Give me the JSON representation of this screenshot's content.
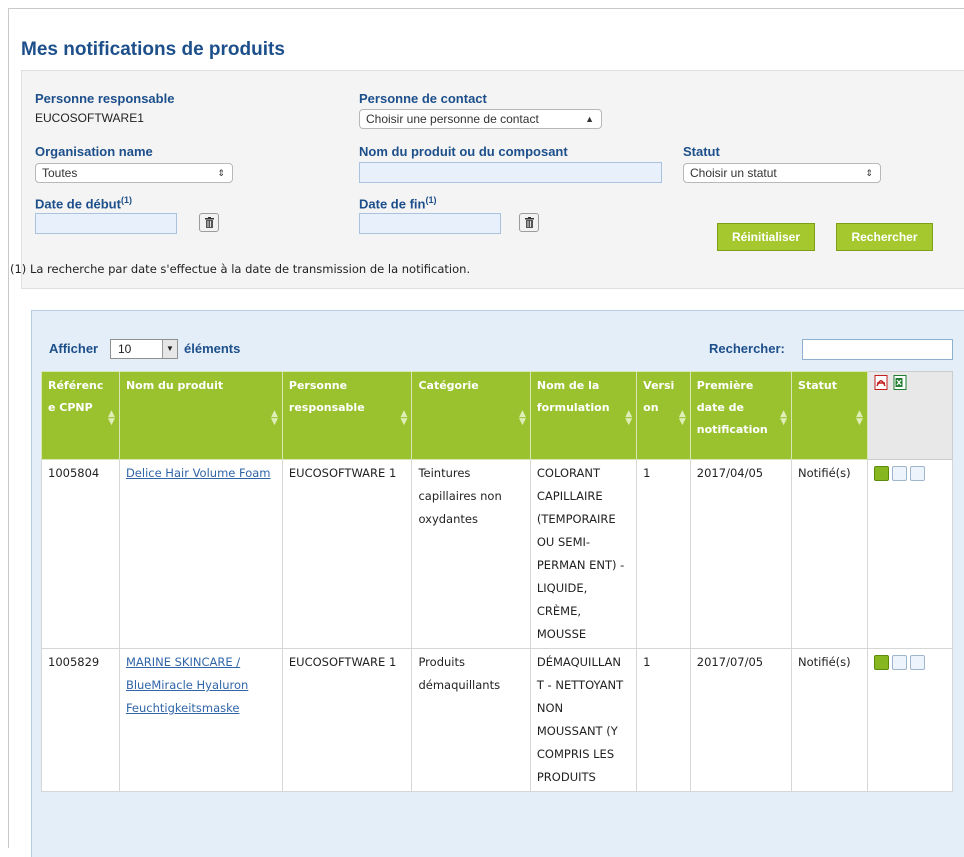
{
  "page": {
    "title": "Mes notifications de produits"
  },
  "filters": {
    "responsible_label": "Personne responsable",
    "responsible_value": "EUCOSOFTWARE1",
    "contact_label": "Personne de contact",
    "contact_select": "Choisir une personne de contact",
    "org_label": "Organisation name",
    "org_select": "Toutes",
    "product_label": "Nom du produit ou du composant",
    "product_value": "",
    "status_label": "Statut",
    "status_select": "Choisir un statut",
    "start_date_label": "Date de début",
    "end_date_label": "Date de fin",
    "footnote_mark": "(1)",
    "reset_button": "Réinitialiser",
    "search_button": "Rechercher",
    "footnote": "(1) La recherche par date s'effectue à la date de transmission de la notification."
  },
  "table_controls": {
    "show_label": "Afficher",
    "page_length": "10",
    "elements_label": "éléments",
    "search_label": "Rechercher:"
  },
  "table": {
    "headers": [
      "Référenc\ne CPNP",
      "Nom du produit",
      "Personne\nresponsable",
      "Catégorie",
      "Nom de la\nformulation",
      "Versi\non",
      "Première\ndate de\nnotification",
      "Statut"
    ],
    "rows": [
      {
        "ref": "1005804",
        "product": "Delice Hair Volume Foam",
        "responsible": "EUCOSOFTWARE 1",
        "category": "Teintures capillaires non oxydantes",
        "formulation": "COLORANT CAPILLAIRE (TEMPORAIRE OU SEMI-PERMAN ENT) - LIQUIDE, CRÈME, MOUSSE",
        "version": "1",
        "first_date": "2017/04/05",
        "status": "Notifié(s)"
      },
      {
        "ref": "1005829",
        "product": "MARINE SKINCARE / BlueMiracle Hyaluron Feuchtigkeitsmaske",
        "responsible": "EUCOSOFTWARE 1",
        "category": "Produits démaquillants",
        "formulation": "DÉMAQUILLAN T - NETTOYANT NON MOUSSANT (Y COMPRIS LES PRODUITS",
        "version": "1",
        "first_date": "2017/07/05",
        "status": "Notifié(s)"
      }
    ]
  },
  "colors": {
    "title_blue": "#1d4f8b",
    "header_green": "#9ac22f",
    "button_green": "#a4c82d",
    "link_blue": "#3065a8"
  },
  "icons": [
    "trash-icon",
    "pdf-export-icon",
    "excel-export-icon",
    "edit-icon",
    "view-icon",
    "copy-icon"
  ]
}
